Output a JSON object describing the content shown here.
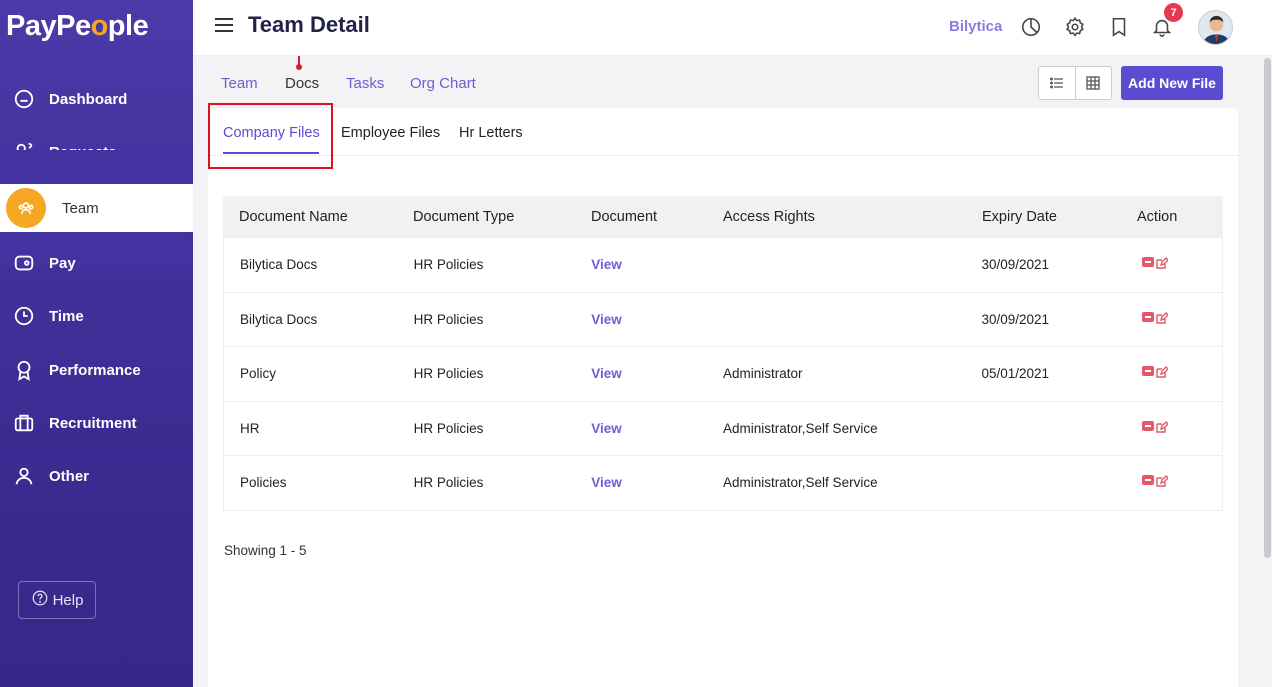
{
  "app": {
    "logo_prefix": "PayPe",
    "logo_o": "o",
    "logo_suffix": "ple"
  },
  "sidebar": {
    "items": [
      {
        "label": "Dashboard",
        "icon": "home-icon"
      },
      {
        "label": "Requests",
        "icon": "requests-icon"
      },
      {
        "label": "Team",
        "icon": "team-icon"
      },
      {
        "label": "Pay",
        "icon": "wallet-icon"
      },
      {
        "label": "Time",
        "icon": "clock-icon"
      },
      {
        "label": "Performance",
        "icon": "award-icon"
      },
      {
        "label": "Recruitment",
        "icon": "briefcase-icon"
      },
      {
        "label": "Other",
        "icon": "user-icon"
      }
    ],
    "active": "Team",
    "help_label": "Help"
  },
  "header": {
    "title": "Team Detail",
    "company": "Bilytica",
    "notification_count": "7"
  },
  "subnav": {
    "tabs": [
      "Team",
      "Docs",
      "Tasks",
      "Org Chart"
    ],
    "active": "Docs",
    "add_button": "Add New File"
  },
  "card_tabs": {
    "tabs": [
      "Company Files",
      "Employee Files",
      "Hr Letters"
    ],
    "active": "Company Files"
  },
  "table": {
    "columns": [
      "Document Name",
      "Document Type",
      "Document",
      "Access Rights",
      "Expiry Date",
      "Action"
    ],
    "rows": [
      {
        "name": "Bilytica Docs",
        "type": "HR Policies",
        "doc": "View",
        "access": "",
        "expiry": "30/09/2021"
      },
      {
        "name": "Bilytica Docs",
        "type": "HR Policies",
        "doc": "View",
        "access": "",
        "expiry": "30/09/2021"
      },
      {
        "name": "Policy",
        "type": "HR Policies",
        "doc": "View",
        "access": "Administrator",
        "expiry": "05/01/2021"
      },
      {
        "name": "HR",
        "type": "HR Policies",
        "doc": "View",
        "access": "Administrator,Self Service",
        "expiry": ""
      },
      {
        "name": "Policies",
        "type": "HR Policies",
        "doc": "View",
        "access": "Administrator,Self Service",
        "expiry": ""
      }
    ]
  },
  "pagination": {
    "showing": "Showing 1 - 5"
  },
  "colors": {
    "sidebar": "#4b3aa8",
    "accent": "#5a4cd1",
    "logo_accent": "#f5a623",
    "badge": "#e53950",
    "highlight": "#e0101e"
  }
}
